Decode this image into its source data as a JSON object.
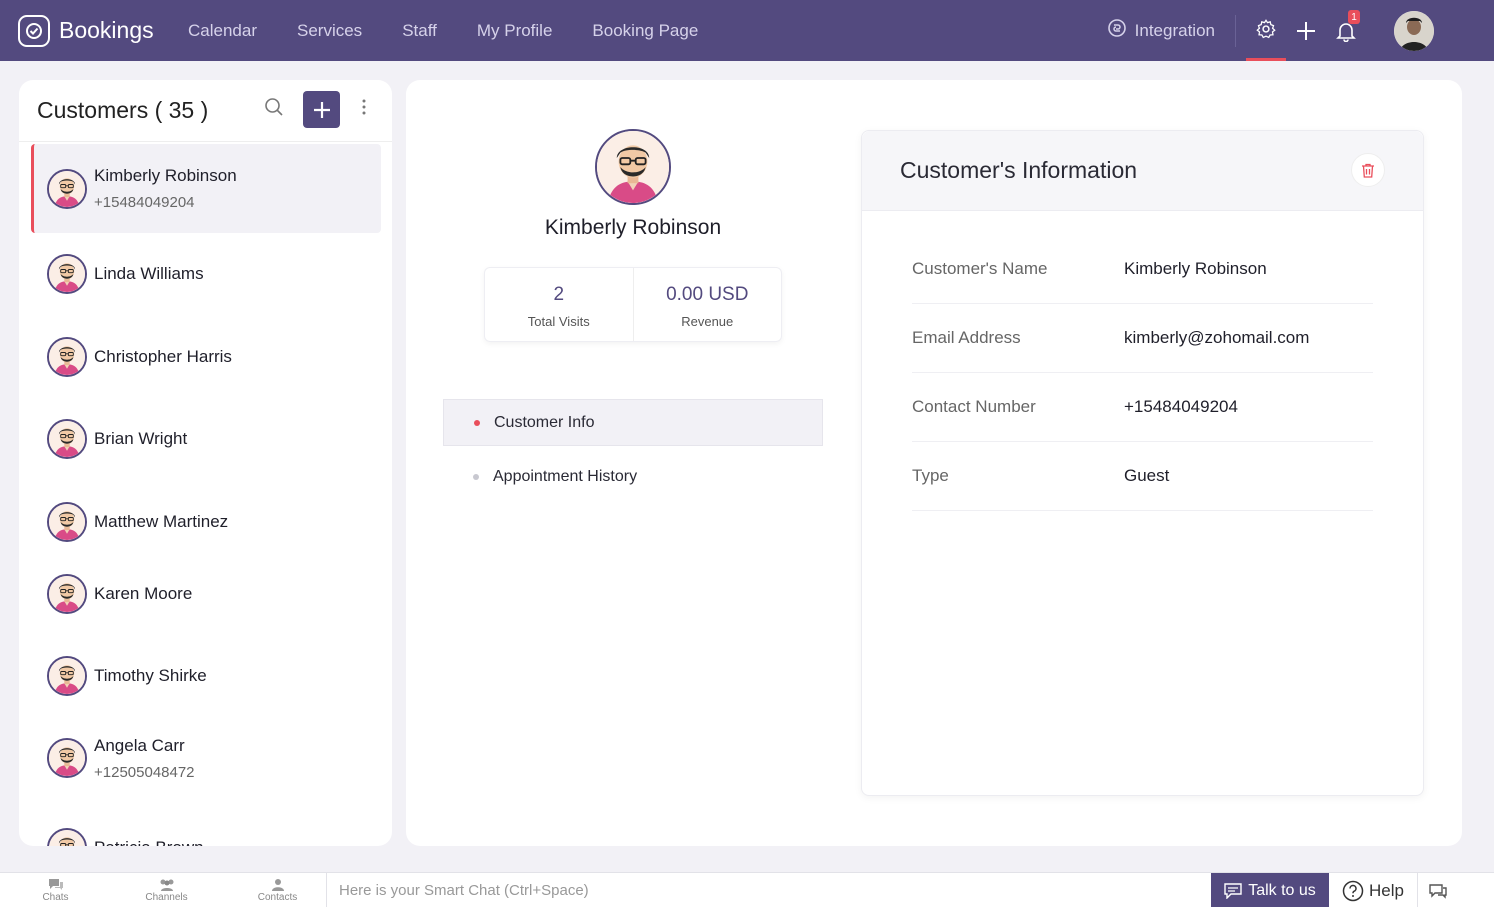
{
  "topbar": {
    "brand": "Bookings",
    "nav": [
      "Calendar",
      "Services",
      "Staff",
      "My Profile",
      "Booking Page"
    ],
    "integration_label": "Integration",
    "notification_count": "1"
  },
  "customers": {
    "title": "Customers ( 35 )",
    "items": [
      {
        "name": "Kimberly Robinson",
        "phone": "+15484049204"
      },
      {
        "name": "Linda Williams",
        "phone": ""
      },
      {
        "name": "Christopher Harris",
        "phone": ""
      },
      {
        "name": "Brian Wright",
        "phone": ""
      },
      {
        "name": "Matthew Martinez",
        "phone": ""
      },
      {
        "name": "Karen Moore",
        "phone": ""
      },
      {
        "name": "Timothy Shirke",
        "phone": ""
      },
      {
        "name": "Angela Carr",
        "phone": "+12505048472"
      },
      {
        "name": "Patricia Brown",
        "phone": ""
      }
    ]
  },
  "profile": {
    "name": "Kimberly Robinson",
    "visits_value": "2",
    "visits_label": "Total Visits",
    "revenue_value": "0.00 USD",
    "revenue_label": "Revenue",
    "tabs": [
      "Customer Info",
      "Appointment History"
    ]
  },
  "info": {
    "title": "Customer's Information",
    "rows": [
      {
        "label": "Customer's Name",
        "value": "Kimberly Robinson"
      },
      {
        "label": "Email Address",
        "value": "kimberly@zohomail.com"
      },
      {
        "label": "Contact Number",
        "value": "+15484049204"
      },
      {
        "label": "Type",
        "value": "Guest"
      }
    ]
  },
  "bottombar": {
    "chats": "Chats",
    "channels": "Channels",
    "contacts": "Contacts",
    "chat_placeholder": "Here is your Smart Chat (Ctrl+Space)",
    "talk": "Talk to us",
    "help": "Help"
  },
  "colors": {
    "accent": "#534a7f",
    "highlight": "#e94e5b"
  }
}
